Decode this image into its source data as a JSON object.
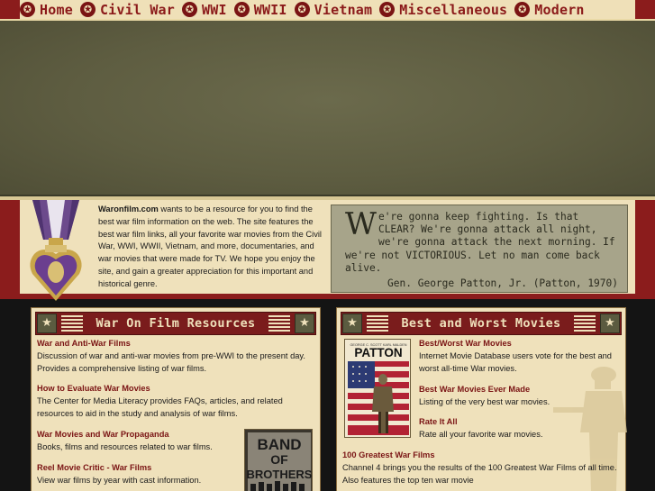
{
  "nav": {
    "items": [
      {
        "label": "Home"
      },
      {
        "label": "Civil War"
      },
      {
        "label": "WWI"
      },
      {
        "label": "WWII"
      },
      {
        "label": "Vietnam"
      },
      {
        "label": "Miscellaneous"
      },
      {
        "label": "Modern"
      }
    ],
    "star_glyph": "✪"
  },
  "intro": {
    "site_name": "Waronfilm.com",
    "text": " wants to be a resource for you to find the best war film information on the web. The site features the best war film links, all your favorite war movies from the Civil War, WWI, WWII, Vietnam, and more, documentaries, and war movies that were made for TV. We hope you enjoy the site, and gain a greater appreciation for this important and historical genre."
  },
  "quote": {
    "dropcap": "W",
    "text": "e're gonna keep fighting. Is that CLEAR? We're gonna attack all night, we're gonna attack the next morning. If we're not VICTORIOUS. Let no man come back alive.",
    "attribution": "Gen. George Patton, Jr. (Patton, 1970)"
  },
  "left_panel": {
    "title": "War On Film Resources",
    "entries": [
      {
        "link": "War and Anti-War Films",
        "desc": "Discussion of war and anti-war movies from pre-WWI to the present day. Provides a comprehensive listing of war films."
      },
      {
        "link": "How to Evaluate War Movies",
        "desc": "The Center for Media Literacy provides FAQs, articles, and related resources to aid in the study and analysis of war films."
      },
      {
        "link": "War Movies and War Propaganda",
        "desc": "Books, films and resources related to war films."
      },
      {
        "link": "Reel Movie Critic - War Films",
        "desc": "View war films by year with cast information."
      }
    ],
    "poster": {
      "line1": "BAND",
      "line2": "OF",
      "line3": "BROTHERS"
    }
  },
  "right_panel": {
    "title": "Best and Worst Movies",
    "entries": [
      {
        "link": "Best/Worst War Movies",
        "desc": "Internet Movie Database users vote for the best and worst all-time War movies."
      },
      {
        "link": "Best War Movies Ever Made",
        "desc": "Listing of the very best war movies."
      },
      {
        "link": "Rate It All",
        "desc": "Rate all your favorite war movies."
      },
      {
        "link": "100 Greatest War Films",
        "desc": "Channel 4 brings you the results of the 100 Greatest War Films of all time. Also features the top ten war movie"
      }
    ],
    "poster": {
      "credits": "GEORGE C. SCOTT     KARL MALDEN",
      "title": "PATTON"
    }
  },
  "colors": {
    "nav_red": "#8b1c1c",
    "cream": "#efe1bb",
    "olive": "#5e5e43",
    "link_red": "#7a1414"
  }
}
